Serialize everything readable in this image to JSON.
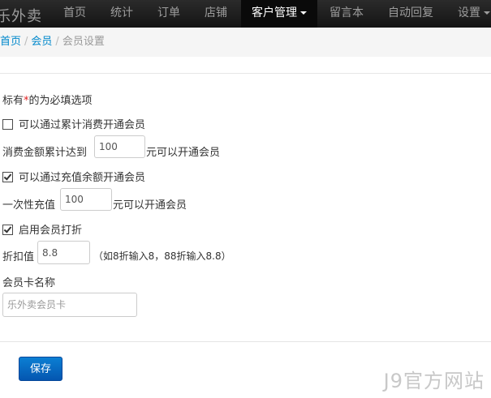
{
  "navbar": {
    "brand": "乐外卖",
    "items": [
      "首页",
      "统计",
      "订单",
      "店铺",
      "客户管理",
      "留言本",
      "自动回复",
      "设置"
    ]
  },
  "breadcrumb": {
    "home": "首页",
    "members": "会员",
    "current": "会员设置",
    "separator": "/"
  },
  "form": {
    "required_note_prefix": "标有",
    "required_star": "*",
    "required_note_suffix": "的为必填选项",
    "option_cumulative": {
      "label": "可以通过累计消费开通会员",
      "checked": false
    },
    "cumulative_prefix": "消费金额累计达到",
    "cumulative_value": "100",
    "cumulative_suffix": "元可以开通会员",
    "option_recharge": {
      "label": "可以通过充值余额开通会员",
      "checked": true
    },
    "recharge_prefix": "一次性充值",
    "recharge_value": "100",
    "recharge_suffix": "元可以开通会员",
    "option_discount": {
      "label": "启用会员打折",
      "checked": true
    },
    "discount_prefix": "折扣值",
    "discount_value": "8.8",
    "discount_hint": "（如8折输入8，88折输入8.8）",
    "card_name_label": "会员卡名称",
    "card_name_placeholder": "乐外卖会员卡",
    "save_label": "保存"
  },
  "watermark": "J9官方网站",
  "colors": {
    "navbar_bg": "#1b1b1b",
    "link": "#0088cc",
    "primary_button": "#0668c4",
    "required": "#e02020"
  }
}
